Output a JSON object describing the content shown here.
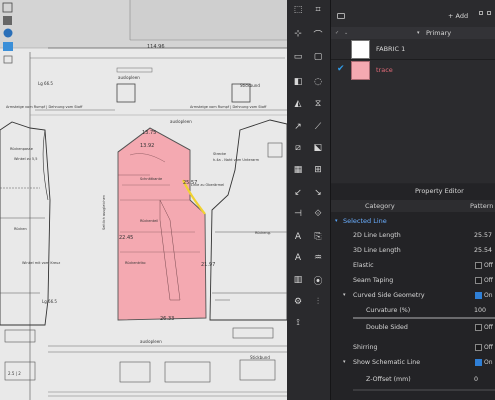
{
  "canvas": {
    "measure_top": "114.96",
    "label_ausziepleen_top": "auslopleen",
    "label_ausziepleen_mid": "auslopleen",
    "label_ausziepleen_bot": "auslopleen",
    "label_armsteg": "Armsteige vom Rumpf | Dehnung vom Stoff",
    "label_armsteg_top": "Armsteige vom Rumpf | Dehnung vom Stoff",
    "label_lg_top": "Lg 66.5",
    "label_lg_bot": "Lg 66.5",
    "label_ruckeng": "Rückeng.",
    "label_winkel": "Winkel zu 5,5",
    "label_rucken": "Rücken",
    "label_winkel2": "Winkel mit vom Kreuz",
    "label_ruckenpasse": "Rückenpasse",
    "label_stickbund": "Stickbund",
    "label_stickbund2": "Stickbund",
    "label_seitl": "Seitlich ausgleichen",
    "label_strecke": "Strecke",
    "label_naht": "h.4a - Naht vom Unterarm",
    "measure_1375": "13.75",
    "measure_1392": "13.92",
    "measure_2557": "25.57",
    "measure_2445": "22.45",
    "measure_2197": "21.97",
    "measure_2633": "26.33",
    "label_schnittkante": "Schnittkante",
    "label_ruckenteil": "Rückenteil",
    "label_ruckentriko": "Rückentriko",
    "label_liniezu": "Linie zu Oberärmel",
    "measure_25": "2.5 | 2"
  },
  "fabric_panel": {
    "add_label": "+ Add",
    "section_title": "Primary",
    "items": [
      {
        "name": "FABRIC 1",
        "swatch": "#ffffff",
        "checked": false
      },
      {
        "name": "trace",
        "swatch": "#f4a9b1",
        "checked": true
      }
    ]
  },
  "property_editor": {
    "title": "Property Editor",
    "col_category": "Category",
    "col_pattern": "Pattern",
    "section": "Selected Line",
    "rows": [
      {
        "name": "2D Line Length",
        "value": "25.57"
      },
      {
        "name": "3D Line Length",
        "value": "25.54"
      },
      {
        "name": "Elastic",
        "value": "Off"
      },
      {
        "name": "Seam Taping",
        "value": "Off"
      },
      {
        "name": "Curved Side Geometry",
        "value": "On"
      },
      {
        "name": "Curvature (%)",
        "value": "100"
      },
      {
        "name": "Double Sided",
        "value": "Off"
      },
      {
        "name": "Shirring",
        "value": "Off"
      },
      {
        "name": "Show Schematic Line",
        "value": "On"
      },
      {
        "name": "Z-Offset (mm)",
        "value": "0"
      }
    ]
  },
  "colors": {
    "accent": "#2f7fd6",
    "trace_fill": "#f4a9b1",
    "highlight_line": "#f1d232",
    "panel_bg": "#252528"
  }
}
